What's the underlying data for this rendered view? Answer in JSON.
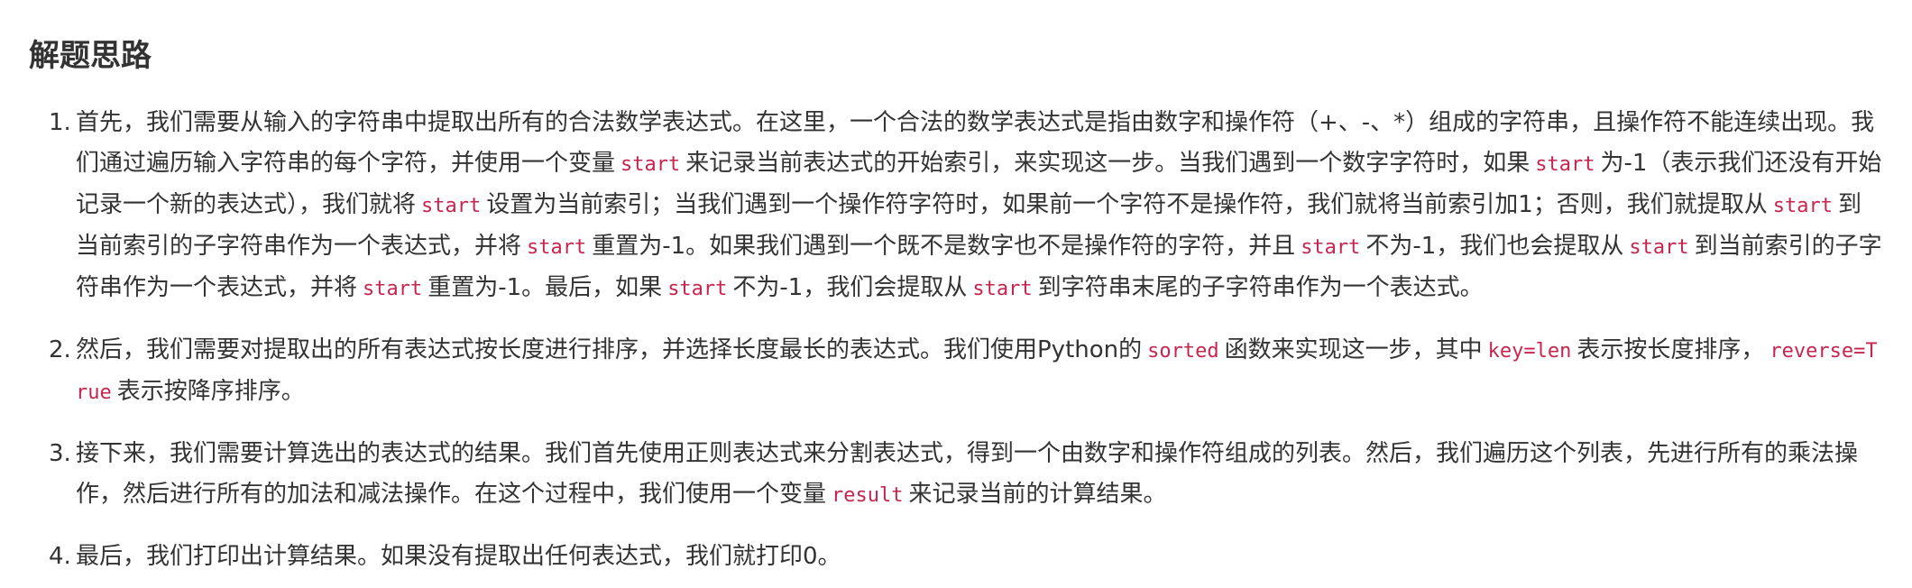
{
  "title": "解题思路",
  "steps": [
    {
      "number": "1.",
      "segments": [
        {
          "text": "首先，我们需要从输入的字符串中提取出所有的合法数学表达式。在这里，一个合法的数学表达式是指由数字和操作符（+、-、*）组成的字符串，且操作符不能连续出现。我们通过遍历输入字符串的每个字符，并使用一个变量"
        },
        {
          "code": "start"
        },
        {
          "text": "来记录当前表达式的开始索引，来实现这一步。当我们遇到一个数字字符时，如果"
        },
        {
          "code": "start"
        },
        {
          "text": "为-1（表示我们还没有开始记录一个新的表达式），我们就将"
        },
        {
          "code": "start"
        },
        {
          "text": "设置为当前索引；当我们遇到一个操作符字符时，如果前一个字符不是操作符，我们就将当前索引加1；否则，我们就提取从"
        },
        {
          "code": "start"
        },
        {
          "text": "到当前索引的子字符串作为一个表达式，并将"
        },
        {
          "code": "start"
        },
        {
          "text": "重置为-1。如果我们遇到一个既不是数字也不是操作符的字符，并且"
        },
        {
          "code": "start"
        },
        {
          "text": "不为-1，我们也会提取从"
        },
        {
          "code": "start"
        },
        {
          "text": "到当前索引的子字符串作为一个表达式，并将"
        },
        {
          "code": "start"
        },
        {
          "text": "重置为-1。最后，如果"
        },
        {
          "code": "start"
        },
        {
          "text": "不为-1，我们会提取从"
        },
        {
          "code": "start"
        },
        {
          "text": "到字符串末尾的子字符串作为一个表达式。"
        }
      ]
    },
    {
      "number": "2.",
      "segments": [
        {
          "text": "然后，我们需要对提取出的所有表达式按长度进行排序，并选择长度最长的表达式。我们使用Python的"
        },
        {
          "code": "sorted"
        },
        {
          "text": "函数来实现这一步，其中"
        },
        {
          "code": "key=len"
        },
        {
          "text": "表示按长度排序，"
        },
        {
          "code": "reverse=True"
        },
        {
          "text": "表示按降序排序。"
        }
      ]
    },
    {
      "number": "3.",
      "segments": [
        {
          "text": "接下来，我们需要计算选出的表达式的结果。我们首先使用正则表达式来分割表达式，得到一个由数字和操作符组成的列表。然后，我们遍历这个列表，先进行所有的乘法操作，然后进行所有的加法和减法操作。在这个过程中，我们使用一个变量"
        },
        {
          "code": "result"
        },
        {
          "text": "来记录当前的计算结果。"
        }
      ]
    },
    {
      "number": "4.",
      "segments": [
        {
          "text": "最后，我们打印出计算结果。如果没有提取出任何表达式，我们就打印0。"
        }
      ]
    }
  ]
}
